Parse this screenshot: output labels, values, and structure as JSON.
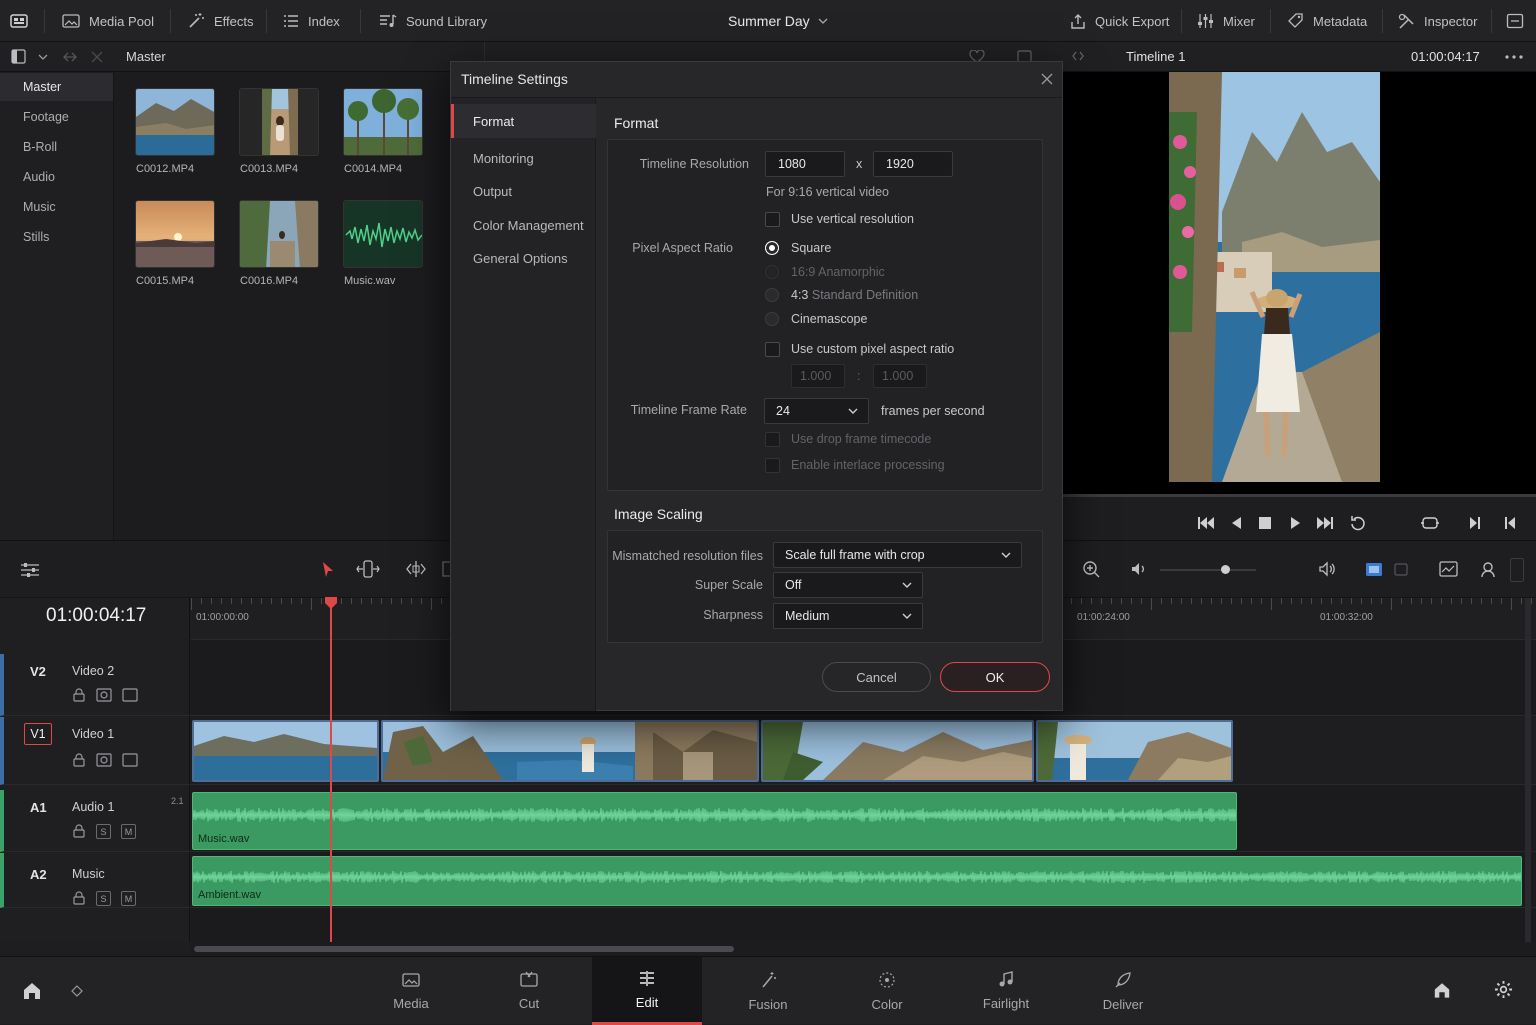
{
  "topbar": {
    "media_pool": "Media Pool",
    "effects": "Effects",
    "index": "Index",
    "sound_library": "Sound Library",
    "project_title": "Summer Day",
    "quick_export": "Quick Export",
    "mixer": "Mixer",
    "metadata": "Metadata",
    "inspector": "Inspector"
  },
  "subbar": {
    "bin_path": "Master",
    "timeline_name": "Timeline 1",
    "viewer_timecode": "01:00:04:17"
  },
  "bins": [
    "Master",
    "Footage",
    "B-Roll",
    "Audio",
    "Music",
    "Stills"
  ],
  "clips": [
    "C0012.MP4",
    "C0013.MP4",
    "C0014.MP4",
    "C0015.MP4",
    "C0016.MP4",
    "Music.wav"
  ],
  "timeline": {
    "timecode": "01:00:04:17",
    "ruler_labels": [
      "01:00:00:00",
      "01:00:24:00",
      "01:00:32:00"
    ],
    "tracks": [
      {
        "id": "V2",
        "name": "Video 2"
      },
      {
        "id": "V1",
        "name": "Video 1"
      },
      {
        "id": "A1",
        "name": "Audio 1",
        "channels": "2.1"
      },
      {
        "id": "A2",
        "name": "Music"
      }
    ],
    "audio_clips": [
      "Music.wav",
      "Ambient.wav"
    ],
    "solo_label": "S",
    "mute_label": "M"
  },
  "pages": [
    "Media",
    "Cut",
    "Edit",
    "Fusion",
    "Color",
    "Fairlight",
    "Deliver"
  ],
  "active_page": "Edit",
  "dialog": {
    "title": "Timeline Settings",
    "nav": [
      "Format",
      "Monitoring",
      "Output",
      "Color Management",
      "General Options"
    ],
    "format_section": "Format",
    "timeline_resolution_label": "Timeline Resolution",
    "res_width": "1080",
    "res_x": "x",
    "res_height": "1920",
    "res_hint": "For 9:16 vertical video",
    "use_vertical_label": "Use vertical resolution",
    "pixel_aspect_label": "Pixel Aspect Ratio",
    "par_options": [
      {
        "label": "Square",
        "selected": true,
        "enabled": true
      },
      {
        "label": "16:9 Anamorphic",
        "selected": false,
        "enabled": false
      },
      {
        "label_prefix": "4:3",
        "label_suffix": " Standard Definition",
        "selected": false,
        "enabled": true
      },
      {
        "label": "Cinemascope",
        "selected": false,
        "enabled": true
      }
    ],
    "custom_par_label": "Use custom pixel aspect ratio",
    "custom_par_w": "1.000",
    "custom_par_sep": ":",
    "custom_par_h": "1.000",
    "frame_rate_label": "Timeline Frame Rate",
    "frame_rate_value": "24",
    "frame_rate_unit": "frames per second",
    "drop_frame_label": "Use drop frame timecode",
    "interlace_label": "Enable interlace processing",
    "image_scaling_section": "Image Scaling",
    "mismatched_label": "Mismatched resolution files",
    "mismatched_value": "Scale full frame with crop",
    "super_scale_label": "Super Scale",
    "super_scale_value": "Off",
    "sharpness_label": "Sharpness",
    "sharpness_value": "Medium",
    "cancel": "Cancel",
    "ok": "OK"
  },
  "colors": {
    "accent_red": "#e04848",
    "audio_green": "#3b9a62",
    "clip_blue": "#4e6e97"
  }
}
